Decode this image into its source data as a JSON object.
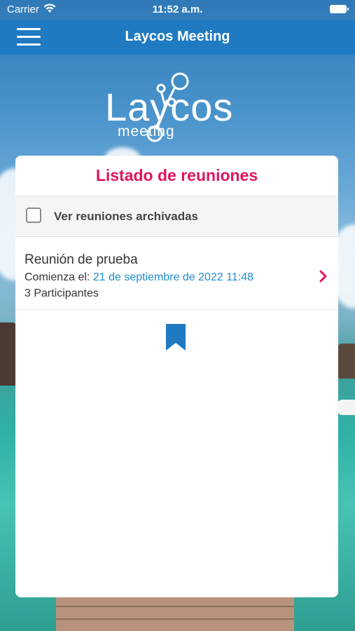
{
  "status_bar": {
    "carrier": "Carrier",
    "time": "11:52 a.m."
  },
  "nav": {
    "title": "Laycos Meeting",
    "menu_icon": "hamburger-menu-icon"
  },
  "logo": {
    "main": "Laycos",
    "sub": "meeting"
  },
  "card": {
    "title": "Listado de reuniones",
    "archived_label": "Ver reuniones archivadas",
    "archived_checked": false,
    "meetings": [
      {
        "name": "Reunión de prueba",
        "start_label": "Comienza el:",
        "start_date": "21 de septiembre de 2022 11:48",
        "participants": "3 Participantes"
      }
    ],
    "bookmark_icon": "bookmark-icon"
  },
  "colors": {
    "nav_bg": "#1f7ac2",
    "title_accent": "#e0155f",
    "date_link": "#1f8cd0",
    "icon_blue": "#1f7ac2"
  }
}
